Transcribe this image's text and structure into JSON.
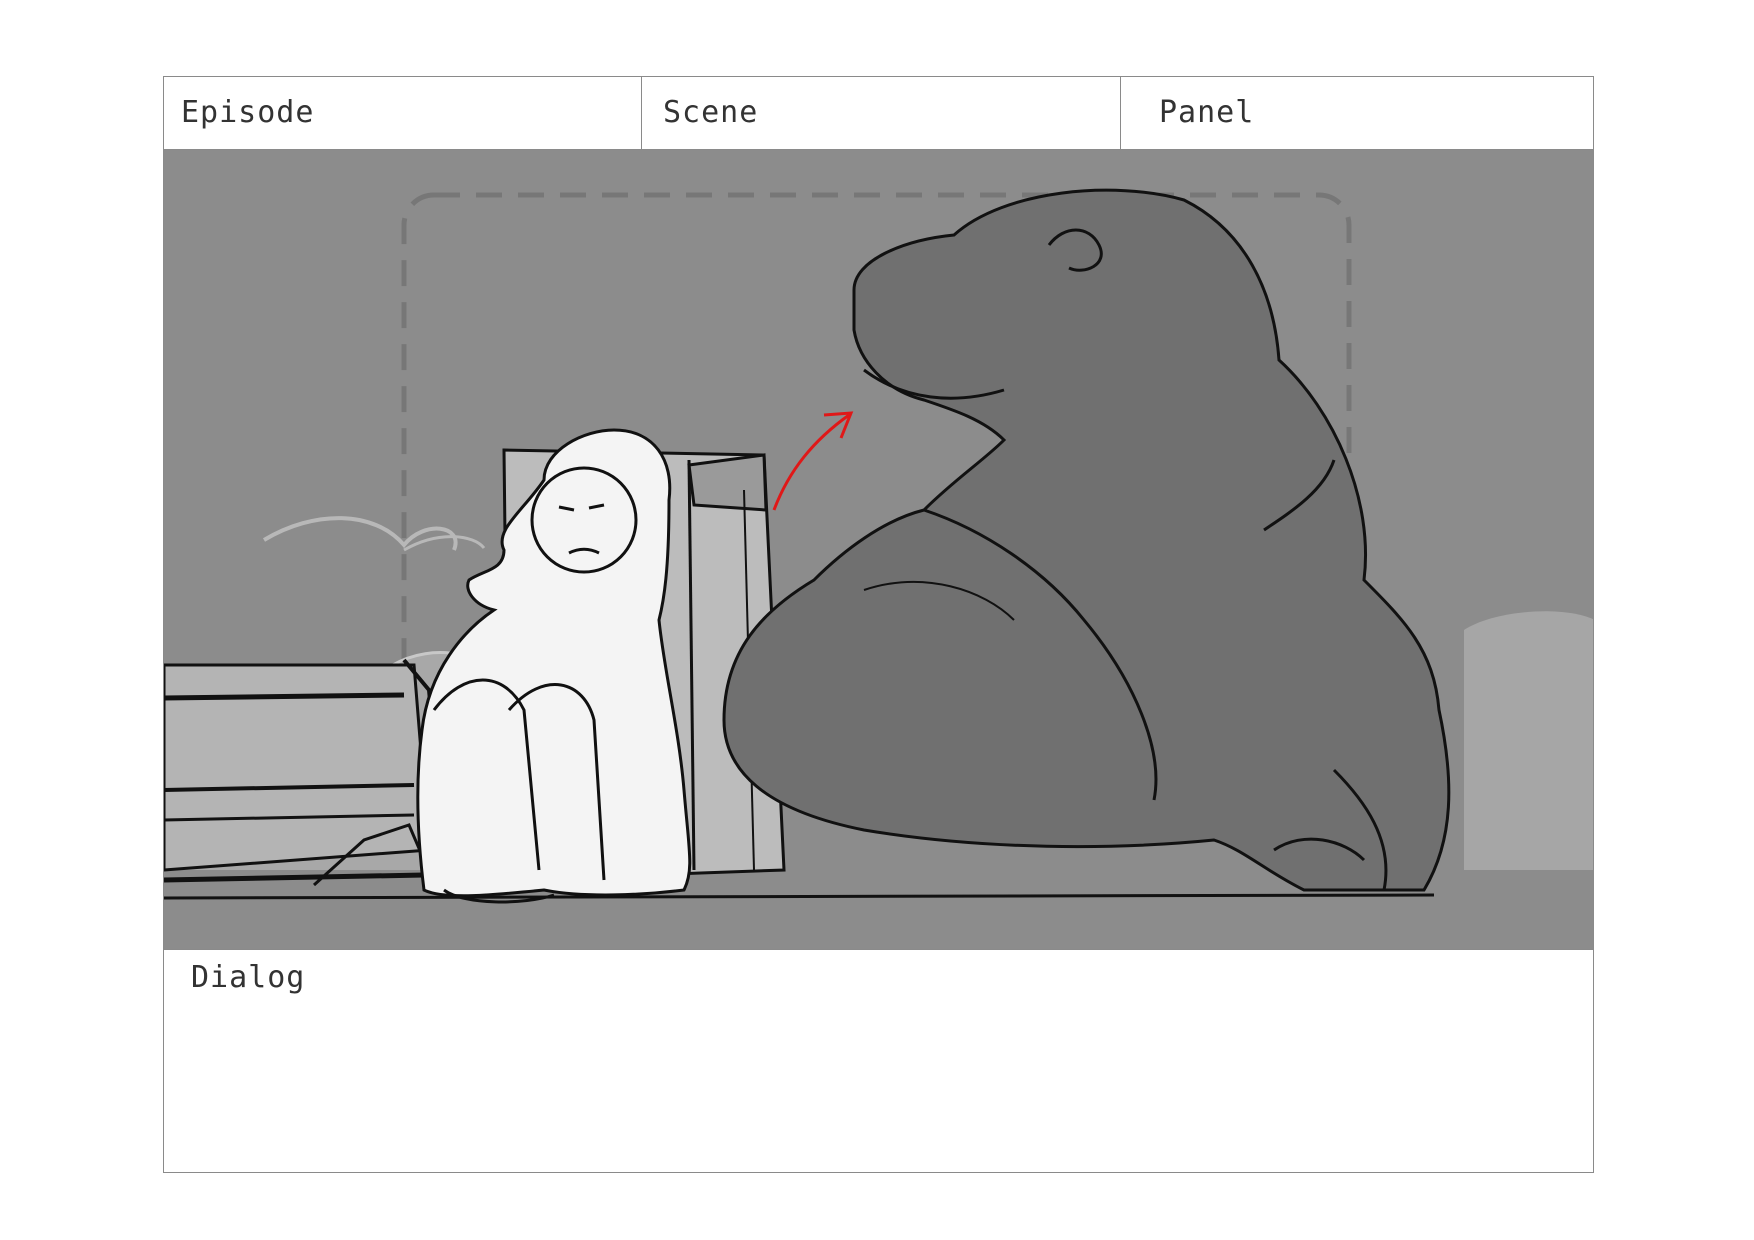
{
  "header": {
    "episode_label": "Episode",
    "scene_label": "Scene",
    "panel_label": "Panel"
  },
  "dialog": {
    "label": "Dialog",
    "text": ""
  },
  "colors": {
    "background": "#8c8c8c",
    "mid_tone": "#b4b4b4",
    "creature": "#6e6e6e",
    "accent_arrow": "#e01818",
    "line": "#111111"
  },
  "drawing": {
    "subject": "storyboard sketch of a crouching girl beside a box and a large dinosaur-like creature",
    "direction_arrow": "red arrow indicating motion"
  }
}
